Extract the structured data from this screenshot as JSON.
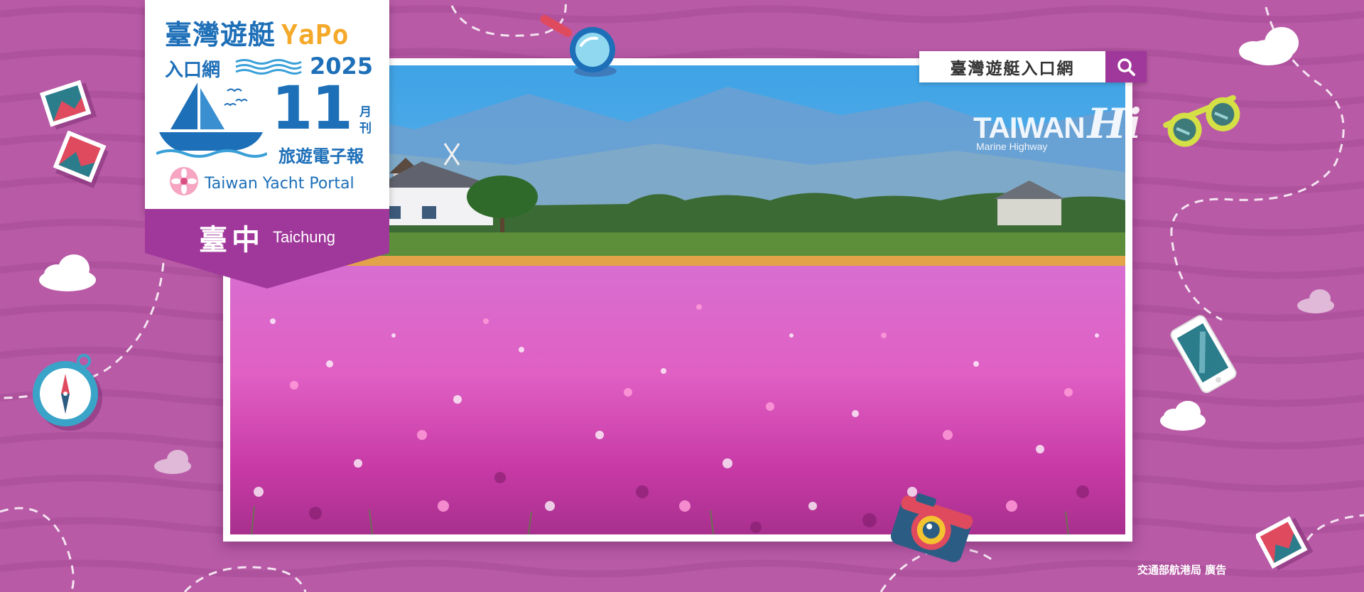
{
  "brand": {
    "title_zh": "臺灣遊艇",
    "title_en": "YaPo",
    "subtitle": "入口網",
    "year": "2025",
    "issue_number": "11",
    "issue_unit": "月刊",
    "description": "旅遊電子報",
    "portal_name": "Taiwan Yacht Portal"
  },
  "city": {
    "name_zh": "臺中",
    "name_en": "Taichung"
  },
  "search": {
    "value": "臺灣遊艇入口網",
    "button_icon": "search-icon"
  },
  "watermark": {
    "main": "TAIWAN",
    "hi": "Hi",
    "sub": "Marine Highway"
  },
  "footer": {
    "note": "交通部航港局 廣告"
  },
  "colors": {
    "background": "#b85aa6",
    "brand_blue": "#1d6fb8",
    "brand_orange": "#f4a92a",
    "ribbon_purple": "#a0379a"
  },
  "icons": [
    "magnifier-icon",
    "sunglasses-icon",
    "phone-icon",
    "camera-icon",
    "compass-icon",
    "postcard-icon",
    "cloud-icon",
    "flower-icon",
    "ship-icon"
  ]
}
